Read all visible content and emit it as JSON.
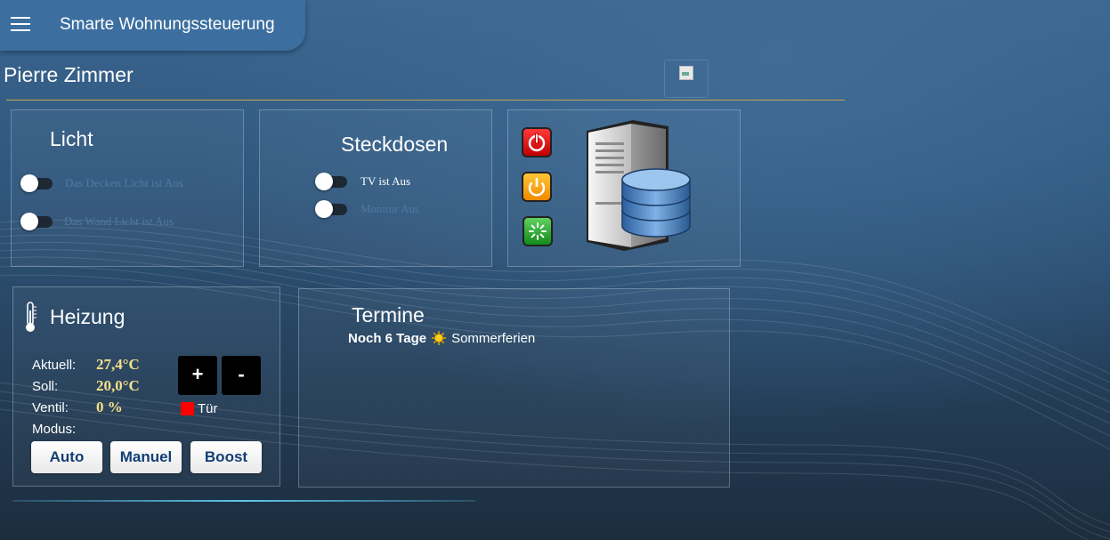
{
  "header": {
    "app_title": "Smarte Wohnungssteuerung",
    "menu_icon": "hamburger-menu-icon"
  },
  "room": {
    "title": "Pierre Zimmer"
  },
  "light_panel": {
    "title": "Licht",
    "switches": [
      {
        "label": "Das Decken Licht ist Aus",
        "state": "off"
      },
      {
        "label": "Das Wand Licht ist Aus",
        "state": "off"
      }
    ]
  },
  "sockets_panel": {
    "title": "Steckdosen",
    "switches": [
      {
        "label": "TV ist Aus",
        "state": "off"
      },
      {
        "label": "Monitor Aus",
        "state": "off"
      }
    ]
  },
  "server_panel": {
    "buttons": [
      {
        "icon": "power-off-icon",
        "color": "#e00000"
      },
      {
        "icon": "standby-icon",
        "color": "#f5a300"
      },
      {
        "icon": "restart-icon",
        "color": "#1c9e28"
      }
    ],
    "image": "server-database-icon"
  },
  "heating_panel": {
    "title": "Heizung",
    "icon": "thermometer-icon",
    "rows": [
      {
        "label": "Aktuell:",
        "value": "27,4°C"
      },
      {
        "label": "Soll:",
        "value": "20,0°C"
      },
      {
        "label": "Ventil:",
        "value": "0 %"
      },
      {
        "label": "Modus:",
        "value": ""
      }
    ],
    "plus_label": "+",
    "minus_label": "-",
    "door_label": "Tür",
    "door_color": "#ff0000",
    "modes": [
      "Auto",
      "Manuel",
      "Boost"
    ]
  },
  "events_panel": {
    "title": "Termine",
    "entry_prefix": "Noch 6 Tage",
    "entry_icon": "sun-icon",
    "entry_text": "Sommerferien"
  },
  "colors": {
    "header_bg": "#3c6f9f",
    "divider": "#c9a54a",
    "value_text": "#f5e08a",
    "mode_button_text": "#123f75"
  }
}
